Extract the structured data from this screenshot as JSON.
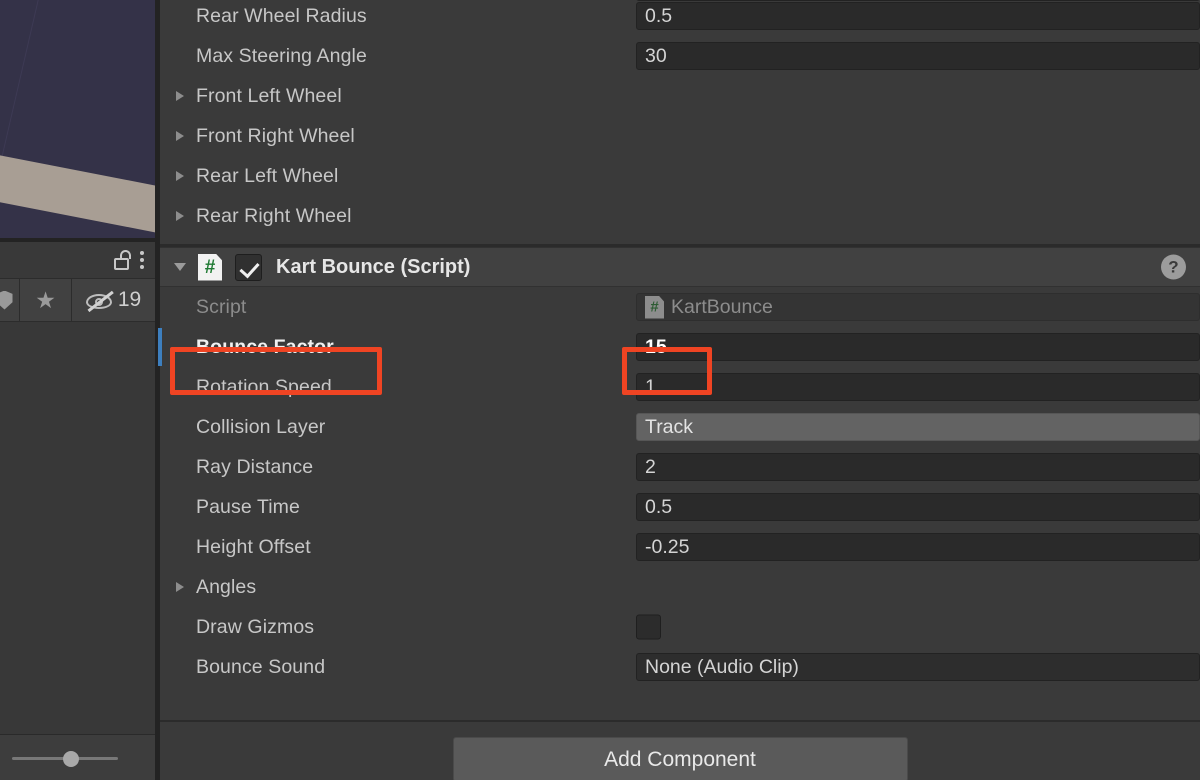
{
  "scene": {
    "background_color": "#343248",
    "track_color": "#a89e94"
  },
  "left_toolbar": {
    "lock_icon": "lock-open-icon",
    "menu_icon": "kebab-menu-icon",
    "shield_icon": "shield-icon",
    "star_icon": "star-icon",
    "hidden_icon": "eye-slash-icon",
    "hidden_count": "19"
  },
  "slider": {
    "name": "zoom-slider",
    "value_percent": 45
  },
  "inspector": {
    "top_properties": [
      {
        "label": "Rear Wheel Radius",
        "value": "0.5",
        "type": "number"
      },
      {
        "label": "Max Steering Angle",
        "value": "30",
        "type": "number"
      }
    ],
    "wheel_foldouts": [
      {
        "label": "Front Left Wheel"
      },
      {
        "label": "Front Right Wheel"
      },
      {
        "label": "Rear Left Wheel"
      },
      {
        "label": "Rear Right Wheel"
      }
    ],
    "component": {
      "title": "Kart Bounce (Script)",
      "enabled": true,
      "expanded": true,
      "script_icon": "csharp-script-icon",
      "help_icon": "help-icon",
      "help_label": "?",
      "properties": [
        {
          "label": "Script",
          "value": "KartBounce",
          "type": "script-ref",
          "disabled": true,
          "icon": "csharp-script-icon"
        },
        {
          "label": "Bounce Factor",
          "value": "15",
          "type": "number",
          "highlighted": true,
          "overridden": true
        },
        {
          "label": "Rotation Speed",
          "value": "1",
          "type": "number"
        },
        {
          "label": "Collision Layer",
          "value": "Track",
          "type": "dropdown"
        },
        {
          "label": "Ray Distance",
          "value": "2",
          "type": "number"
        },
        {
          "label": "Pause Time",
          "value": "0.5",
          "type": "number"
        },
        {
          "label": "Height Offset",
          "value": "-0.25",
          "type": "number"
        },
        {
          "label": "Angles",
          "value": "",
          "type": "foldout"
        },
        {
          "label": "Draw Gizmos",
          "value": "",
          "type": "checkbox",
          "checked": false
        },
        {
          "label": "Bounce Sound",
          "value": "None (Audio Clip)",
          "type": "object-ref"
        }
      ]
    },
    "add_component_label": "Add Component"
  },
  "annotations": {
    "color": "#ef4423",
    "boxes": [
      {
        "name": "bounce-factor-label-highlight"
      },
      {
        "name": "bounce-factor-value-highlight"
      }
    ]
  }
}
